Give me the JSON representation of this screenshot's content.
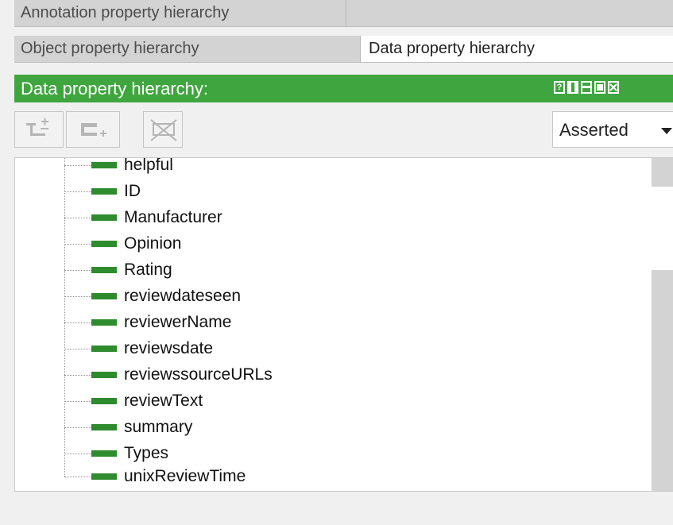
{
  "tabs": {
    "row1": [
      {
        "label": "Annotation property hierarchy"
      }
    ],
    "row2": [
      {
        "label": "Object property hierarchy"
      },
      {
        "label": "Data property hierarchy"
      }
    ],
    "active": "Data property hierarchy"
  },
  "view": {
    "title": "Data property hierarchy:",
    "header_icons": [
      "help-icon",
      "split-vertical-icon",
      "split-horizontal-icon",
      "maximize-icon",
      "close-icon"
    ],
    "header_color": "#3fa63f"
  },
  "toolbar": {
    "buttons": [
      {
        "name": "add-sub-property-button",
        "icon": "add-sub-property-icon",
        "enabled": false
      },
      {
        "name": "add-sibling-property-button",
        "icon": "add-sibling-property-icon",
        "enabled": false
      },
      {
        "name": "delete-property-button",
        "icon": "delete-property-icon",
        "enabled": false
      }
    ],
    "mode": {
      "selected": "Asserted"
    }
  },
  "tree": {
    "icon_color": "#2e8b2e",
    "items": [
      {
        "label": "helpful"
      },
      {
        "label": "ID"
      },
      {
        "label": "Manufacturer"
      },
      {
        "label": "Opinion"
      },
      {
        "label": "Rating"
      },
      {
        "label": "reviewdateseen"
      },
      {
        "label": "reviewerName"
      },
      {
        "label": "reviewsdate"
      },
      {
        "label": "reviewssourceURLs"
      },
      {
        "label": "reviewText"
      },
      {
        "label": "summary"
      },
      {
        "label": "Types"
      },
      {
        "label": "unixReviewTime"
      }
    ]
  }
}
